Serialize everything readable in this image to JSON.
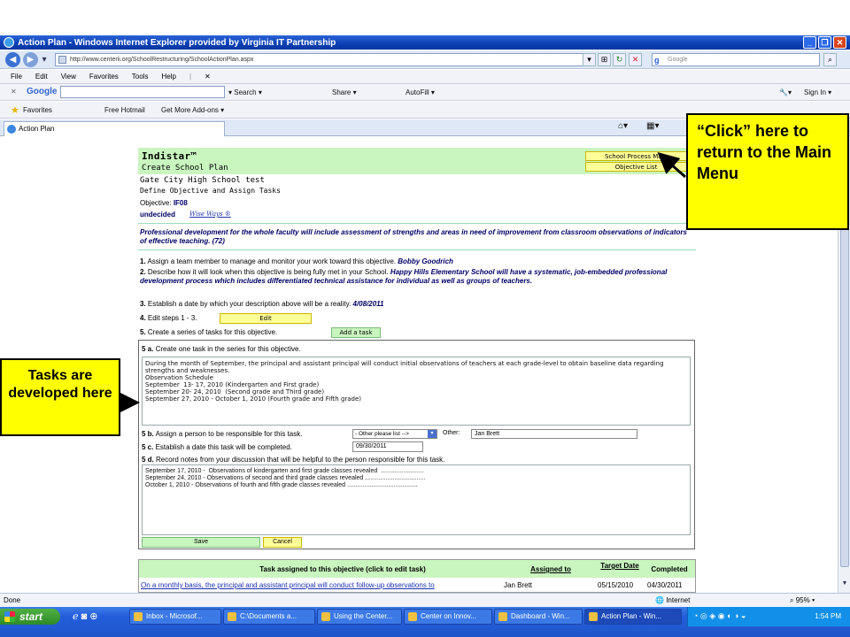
{
  "window": {
    "title": "Action Plan - Windows Internet Explorer provided by Virginia IT Partnership",
    "url": "http://www.centerii.org/SchoolRestructuring/SchoolActionPlan.aspx",
    "search_placeholder": "Google"
  },
  "menu": [
    "File",
    "Edit",
    "View",
    "Favorites",
    "Tools",
    "Help"
  ],
  "google_toolbar": {
    "logo": "Google",
    "search": "Search",
    "share": "Share",
    "autofill": "AutoFill",
    "sign_in": "Sign In"
  },
  "favorites_bar": {
    "favorites": "Favorites",
    "hotmail": "Free Hotmail",
    "addons": "Get More Add-ons"
  },
  "tab": {
    "label": "Action Plan"
  },
  "page": {
    "brand": "Indistar™",
    "subtitle": "Create School Plan",
    "school_name": "Gate City High School test",
    "section_title": "Define Objective and Assign Tasks",
    "school_process_btn": "School Process Main",
    "objective_list_btn": "Objective List",
    "objective_label": "Objective:",
    "objective_code": "IF08",
    "status": "undecided",
    "wise_ways": "Wise Ways ®",
    "objective_text": "Professional development for the whole faculty will include assessment of strengths and areas in need of improvement from classroom observations of indicators of effective teaching. (72)",
    "steps": [
      {
        "num": "1.",
        "text": "Assign a team member to manage and monitor your work toward this objective.",
        "value": "Bobby Goodrich"
      },
      {
        "num": "2.",
        "text": "Describe how it will look when this objective is being fully met in your School.",
        "value": "Happy Hills Elementary School will have a systematic, job-embedded professional development process which includes differentiated technical assistance for individual as well as groups of teachers."
      },
      {
        "num": "3.",
        "text": "Establish a date by which your description above will be a reality.",
        "value": "4/08/2011"
      },
      {
        "num": "4.",
        "text": "Edit steps 1 - 3.",
        "value": ""
      },
      {
        "num": "5.",
        "text": "Create a series of tasks for this objective.",
        "value": ""
      }
    ],
    "edit_btn": "Edit",
    "add_task_btn": "Add a task",
    "task_form": {
      "a_num": "5 a.",
      "a_label": "Create one task in the series for this objective.",
      "a_text": "During the month of September, the principal and assistant principal will conduct initial observations of teachers at each grade-level to obtain baseline data regarding strengths and weaknesses.\nObservation Schedule\nSeptember  13- 17, 2010 (Kindergarten and First grade)\nSeptember 20- 24, 2010  (Second grade and Third grade)\nSeptember 27, 2010 - October 1, 2010 (Fourth grade and Fifth grade)",
      "b_num": "5 b.",
      "b_label": "Assign a person to be responsible for this task.",
      "b_select": "- Other please list -->",
      "b_other_label": "Other:",
      "b_other_value": "Jan Brett",
      "c_num": "5 c.",
      "c_label": "Establish a date this task will be completed.",
      "c_value": "09/30/2011",
      "d_num": "5 d.",
      "d_label": "Record notes from your discussion that will be helpful to the person responsible for this task.",
      "d_text": "September 17, 2010 -  Observations of kindergarten and first grade classes revealed  .........................\nSeptember 24, 2010 - Observations of second and third grade classes revealed ...................................\nOctober 1, 2010 - Observations of fourth and fifth grade classes revealed .........................................",
      "save": "Save",
      "cancel": "Cancel"
    },
    "tasks_table": {
      "headers": [
        "Task assigned to this objective (click to edit task)",
        "Assigned to",
        "Target Date",
        "Completed"
      ],
      "rows": [
        [
          "On a monthly basis, the principal and assistant principal will conduct follow-up observations to",
          "Jan Brett",
          "05/15/2010",
          "04/30/2011"
        ]
      ]
    }
  },
  "callouts": {
    "main": "“Click” here to return to the Main Menu",
    "tasks": "Tasks are developed here"
  },
  "statusbar": {
    "left": "Done",
    "zone": "Internet",
    "zoom": "95%"
  },
  "taskbar": {
    "start": "start",
    "buttons": [
      "Inbox - Microsof...",
      "C:\\Documents a...",
      "Using the Center...",
      "Center on Innov...",
      "Dashboard - Win...",
      "Action Plan - Win..."
    ],
    "clock": "1:54 PM"
  }
}
